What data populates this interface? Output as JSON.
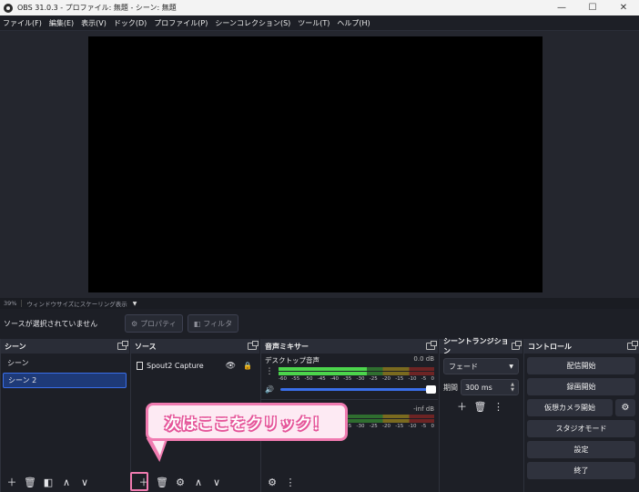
{
  "window": {
    "title": "OBS 31.0.3 - プロファイル: 無題 - シーン: 無題",
    "controls": {
      "minimize": "—",
      "maximize": "☐",
      "close": "✕"
    }
  },
  "menu": [
    "ファイル(F)",
    "編集(E)",
    "表示(V)",
    "ドック(D)",
    "プロファイル(P)",
    "シーンコレクション(S)",
    "ツール(T)",
    "ヘルプ(H)"
  ],
  "preview": {
    "zoom": "39%",
    "scale_mode": "ウィンドウサイズにスケーリング表示"
  },
  "context_bar": {
    "status": "ソースが選択されていません",
    "properties_label": "プロパティ",
    "filters_label": "フィルタ"
  },
  "scenes": {
    "title": "シーン",
    "items": [
      {
        "label": "シーン",
        "selected": false
      },
      {
        "label": "シーン 2",
        "selected": true
      }
    ]
  },
  "sources": {
    "title": "ソース",
    "items": [
      {
        "label": "Spout2 Capture"
      }
    ]
  },
  "mixer": {
    "title": "音声ミキサー",
    "channels": [
      {
        "name": "デスクトップ音声",
        "db": "0.0 dB"
      },
      {
        "name": "",
        "db": "-inf dB"
      }
    ],
    "ticks": [
      "-60",
      "-55",
      "-50",
      "-45",
      "-40",
      "-35",
      "-30",
      "-25",
      "-20",
      "-15",
      "-10",
      "-5",
      "0"
    ]
  },
  "transitions": {
    "title": "シーントランジション",
    "type": "フェード",
    "duration_label": "期間",
    "duration_value": "300 ms"
  },
  "controls": {
    "title": "コントロール",
    "start_streaming": "配信開始",
    "start_recording": "録画開始",
    "start_virtual_cam": "仮想カメラ開始",
    "studio_mode": "スタジオモード",
    "settings": "設定",
    "exit": "終了"
  },
  "annotation": {
    "text": "次はここをクリック！",
    "accent_color": "#f07bb0"
  }
}
